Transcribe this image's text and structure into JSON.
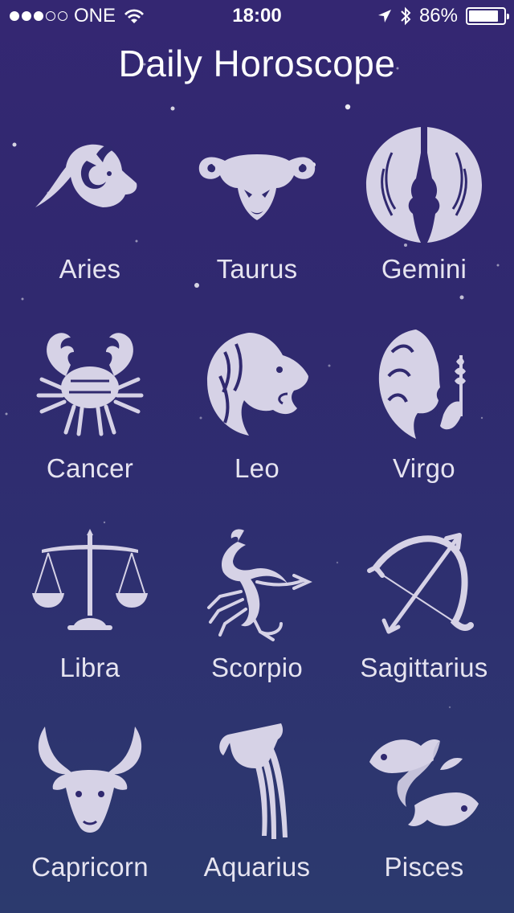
{
  "status_bar": {
    "carrier": "ONE",
    "time": "18:00",
    "battery_percent": "86%",
    "signal_bars_filled": 3,
    "signal_bars_total": 5,
    "battery_level": 0.86
  },
  "title": "Daily Horoscope",
  "signs": [
    {
      "label": "Aries",
      "icon": "ram-head-icon"
    },
    {
      "label": "Taurus",
      "icon": "bull-head-icon"
    },
    {
      "label": "Gemini",
      "icon": "twins-icon"
    },
    {
      "label": "Cancer",
      "icon": "crab-icon"
    },
    {
      "label": "Leo",
      "icon": "lion-head-icon"
    },
    {
      "label": "Virgo",
      "icon": "maiden-icon"
    },
    {
      "label": "Libra",
      "icon": "scales-icon"
    },
    {
      "label": "Scorpio",
      "icon": "scorpion-icon"
    },
    {
      "label": "Sagittarius",
      "icon": "bow-arrow-icon"
    },
    {
      "label": "Capricorn",
      "icon": "goat-head-icon"
    },
    {
      "label": "Aquarius",
      "icon": "water-jug-icon"
    },
    {
      "label": "Pisces",
      "icon": "fishes-icon"
    }
  ],
  "colors": {
    "background_top": "#342772",
    "background_bottom": "#2c3a6e",
    "icon_fill": "#d6d2e6",
    "text": "#ffffff"
  }
}
